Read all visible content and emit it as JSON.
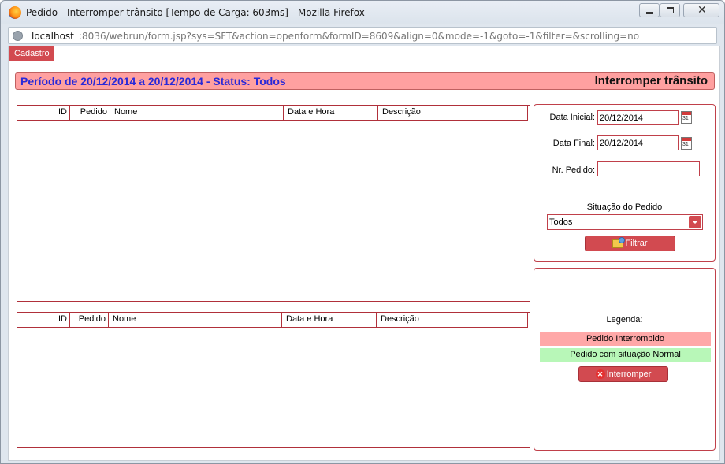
{
  "window": {
    "title": "Pedido - Interromper trânsito [Tempo de Carga: 603ms] - Mozilla Firefox",
    "url_host": "localhost",
    "url_path": ":8036/webrun/form.jsp?sys=SFT&action=openform&formID=8609&align=0&mode=-1&goto=-1&filter=&scrolling=no"
  },
  "tabs": [
    {
      "label": "Cadastro"
    }
  ],
  "header": {
    "period": "Período de 20/12/2014 a 20/12/2014 - Status: Todos",
    "title": "Interromper trânsito"
  },
  "grid_top": {
    "columns": [
      "ID",
      "Pedido",
      "Nome",
      "Data e Hora",
      "Descrição"
    ],
    "rows": []
  },
  "grid_bottom": {
    "columns": [
      "ID",
      "Pedido",
      "Nome",
      "Data e Hora",
      "Descrição"
    ],
    "rows": []
  },
  "filter": {
    "data_inicial_label": "Data Inicial:",
    "data_inicial_value": "20/12/2014",
    "data_final_label": "Data Final:",
    "data_final_value": "20/12/2014",
    "nr_pedido_label": "Nr. Pedido:",
    "nr_pedido_value": "",
    "situacao_label": "Situação do Pedido",
    "situacao_value": "Todos",
    "filtrar_label": "Filtrar",
    "calendar_day": "31"
  },
  "legend": {
    "title": "Legenda:",
    "interrompido": "Pedido Interrompido",
    "normal": "Pedido com situação Normal",
    "interromper_label": "Interromper",
    "colors": {
      "interrompido": "#ffa8a8",
      "normal": "#b8f7b8"
    }
  },
  "icons": [
    "firefox-icon",
    "globe-icon",
    "calendar-icon",
    "folder-search-icon",
    "x-circle-icon"
  ]
}
